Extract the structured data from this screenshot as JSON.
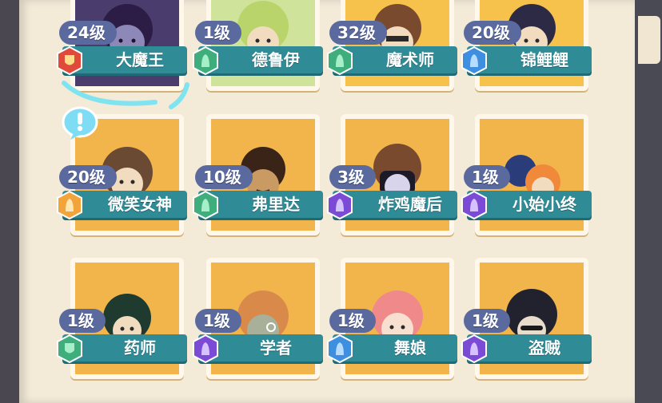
{
  "colors": {
    "card_bg": "#f6c24b",
    "name_bar": "#2f8b96",
    "level_pill": "#5a6a9e",
    "badge_red": "#e04a3a",
    "badge_green": "#3fae7c",
    "badge_blue": "#3e8fe0",
    "badge_purple": "#7c4bd6",
    "badge_orange": "#f2a43a"
  },
  "characters": [
    {
      "level": "24级",
      "name": "大魔王",
      "badge": "red-shield-icon"
    },
    {
      "level": "1级",
      "name": "德鲁伊",
      "badge": "green-hood-icon"
    },
    {
      "level": "32级",
      "name": "魔术师",
      "badge": "green-hood-icon"
    },
    {
      "level": "20级",
      "name": "锦鲤鲤",
      "badge": "blue-hood-icon"
    },
    {
      "level": "20级",
      "name": "微笑女神",
      "badge": "orange-hood-icon"
    },
    {
      "level": "10级",
      "name": "弗里达",
      "badge": "green-hood-icon"
    },
    {
      "level": "3级",
      "name": "炸鸡魔后",
      "badge": "purple-hood-icon"
    },
    {
      "level": "1级",
      "name": "小始小终",
      "badge": "purple-hood-icon"
    },
    {
      "level": "1级",
      "name": "药师",
      "badge": "green-shield-icon"
    },
    {
      "level": "1级",
      "name": "学者",
      "badge": "purple-hood-icon"
    },
    {
      "level": "1级",
      "name": "舞娘",
      "badge": "blue-hood-icon"
    },
    {
      "level": "1级",
      "name": "盗贼",
      "badge": "purple-hood-icon"
    }
  ]
}
